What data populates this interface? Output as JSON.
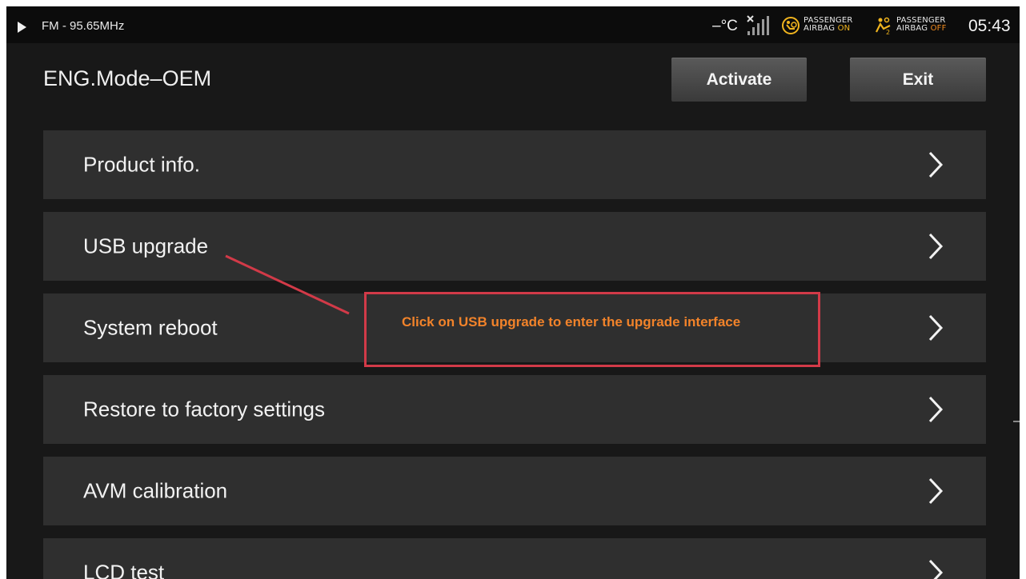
{
  "status_bar": {
    "radio": "FM - 95.65MHz",
    "temperature": "–°C",
    "signal_icon": "no-signal-icon",
    "airbag_1": {
      "line1": "PASSENGER",
      "line2_label": "AIRBAG",
      "line2_state": "ON",
      "icon": "airbag-on-icon"
    },
    "airbag_2": {
      "line1": "PASSENGER",
      "line2_label": "AIRBAG",
      "line2_state": "OFF",
      "icon": "airbag-off-icon"
    },
    "time": "05:43"
  },
  "header": {
    "title": "ENG.Mode–OEM",
    "activate_label": "Activate",
    "exit_label": "Exit"
  },
  "menu": {
    "items": [
      {
        "label": "Product info."
      },
      {
        "label": "USB upgrade"
      },
      {
        "label": "System reboot"
      },
      {
        "label": "Restore to factory settings"
      },
      {
        "label": "AVM calibration"
      },
      {
        "label": "LCD test"
      }
    ]
  },
  "annotation": {
    "text": "Click on USB upgrade to enter the upgrade interface"
  },
  "colors": {
    "background": "#181818",
    "item_background": "#2f2f2f",
    "annotation_border": "#d23a48",
    "annotation_text": "#f2832a",
    "airbag_icon": "#f0b41e"
  }
}
